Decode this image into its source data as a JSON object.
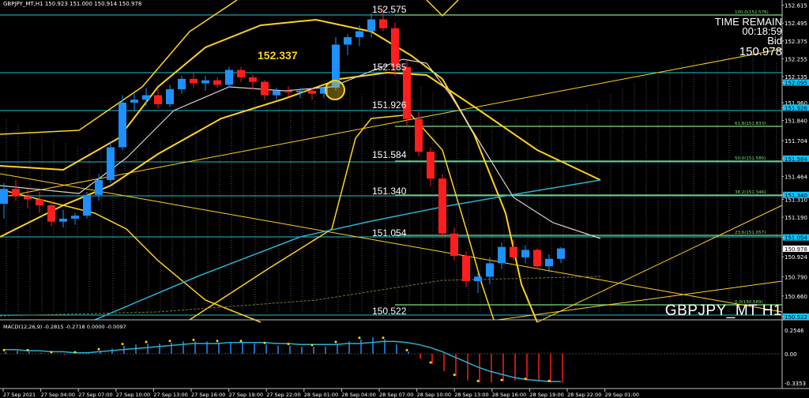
{
  "window": {
    "symbol_header": "GBPJPY_MT,H1  150.923 151.000 150.914 150.978",
    "time_remain_label": "TIME REMAIN",
    "time_remain_value": "00:18:59",
    "bid_label": "Bid",
    "bid_value": "150.978",
    "symbol_label": "GBPJPY_MT H1"
  },
  "levels": {
    "l1": "152.575",
    "l2": "152.337",
    "l3": "152.185",
    "l4": "151.926",
    "l5": "151.584",
    "l6": "151.340",
    "l7": "151.054",
    "l8": "150.522"
  },
  "fib_labels": [
    "100.0(152.576)",
    "61.8(151.833)",
    "50.0(151.580)",
    "38.2(151.346)",
    "23.6(151.057)",
    "0.0(150.589)"
  ],
  "price_axis": {
    "ticks": [
      "152.615",
      "152.495",
      "152.375",
      "152.255",
      "152.135",
      "152.095",
      "151.960",
      "151.926",
      "151.840",
      "151.704",
      "151.584",
      "151.464",
      "151.340",
      "151.310",
      "151.190",
      "151.054",
      "150.978",
      "150.924",
      "150.790",
      "150.660",
      "150.522"
    ],
    "highlight": {
      "152.575": "#00c8ff",
      "152.095": "#00c8ff",
      "151.926": "#00c8ff",
      "151.584": "#00c8ff",
      "151.340": "#00c8ff",
      "151.054": "#00c8ff",
      "150.978": "#ffffff",
      "150.522": "#00c8ff"
    }
  },
  "time_axis": {
    "ticks": [
      "27 Sep 2021",
      "27 Sep 04:00",
      "27 Sep 07:00",
      "27 Sep 10:00",
      "27 Sep 13:00",
      "27 Sep 16:00",
      "27 Sep 19:00",
      "27 Sep 22:00",
      "28 Sep 01:00",
      "28 Sep 04:00",
      "28 Sep 07:00",
      "28 Sep 10:00",
      "28 Sep 13:00",
      "28 Sep 16:00",
      "28 Sep 19:00",
      "28 Sep 22:00",
      "29 Sep 01:00"
    ]
  },
  "macd": {
    "header": "MACD(12,26,9) -0.2815 -0.2718 0.0000 -0.0097",
    "ticks": [
      "0.2546",
      "0.00",
      "-0.3353"
    ]
  },
  "colors": {
    "bull": "#1e90ff",
    "bear": "#ff1e1e",
    "ma_yellow": "#ffd21e",
    "ma_cyan": "#2ab0d0",
    "level": "#7fdc7f"
  },
  "chart_data": {
    "type": "candlestick",
    "symbol": "GBPJPY_MT",
    "timeframe": "H1",
    "ylim": [
      150.5,
      152.65
    ],
    "x": [
      "27 Sep 00:00",
      "01:00",
      "02:00",
      "03:00",
      "04:00",
      "05:00",
      "06:00",
      "07:00",
      "08:00",
      "09:00",
      "10:00",
      "11:00",
      "12:00",
      "13:00",
      "14:00",
      "15:00",
      "16:00",
      "17:00",
      "18:00",
      "19:00",
      "20:00",
      "21:00",
      "22:00",
      "23:00",
      "28 Sep 00:00",
      "01:00",
      "02:00",
      "03:00",
      "04:00",
      "05:00",
      "06:00",
      "07:00",
      "08:00",
      "09:00",
      "10:00",
      "11:00",
      "12:00",
      "13:00",
      "14:00",
      "15:00",
      "16:00",
      "17:00",
      "18:00",
      "19:00",
      "20:00",
      "21:00",
      "22:00",
      "23:00",
      "29 Sep 00:00",
      "01:00"
    ],
    "ohlc": [
      [
        151.28,
        151.42,
        151.18,
        151.38
      ],
      [
        151.38,
        151.44,
        151.3,
        151.33
      ],
      [
        151.33,
        151.38,
        151.25,
        151.31
      ],
      [
        151.31,
        151.36,
        151.22,
        151.27
      ],
      [
        151.27,
        151.3,
        151.13,
        151.16
      ],
      [
        151.16,
        151.24,
        151.12,
        151.18
      ],
      [
        151.18,
        151.22,
        151.14,
        151.2
      ],
      [
        151.2,
        151.36,
        151.18,
        151.34
      ],
      [
        151.34,
        151.48,
        151.3,
        151.44
      ],
      [
        151.44,
        151.7,
        151.42,
        151.66
      ],
      [
        151.66,
        152.01,
        151.64,
        151.96
      ],
      [
        151.96,
        152.02,
        151.9,
        151.98
      ],
      [
        151.98,
        152.06,
        151.94,
        152.01
      ],
      [
        152.01,
        152.05,
        151.92,
        151.95
      ],
      [
        151.95,
        152.08,
        151.93,
        152.05
      ],
      [
        152.05,
        152.14,
        152.02,
        152.12
      ],
      [
        152.12,
        152.16,
        152.06,
        152.09
      ],
      [
        152.09,
        152.14,
        152.04,
        152.11
      ],
      [
        152.11,
        152.13,
        152.06,
        152.08
      ],
      [
        152.08,
        152.2,
        152.06,
        152.18
      ],
      [
        152.18,
        152.2,
        152.1,
        152.13
      ],
      [
        152.13,
        152.15,
        152.05,
        152.1
      ],
      [
        152.1,
        152.11,
        151.98,
        152.01
      ],
      [
        152.01,
        152.06,
        151.98,
        152.04
      ],
      [
        152.04,
        152.07,
        152.0,
        152.03
      ],
      [
        152.03,
        152.06,
        151.99,
        152.04
      ],
      [
        152.04,
        152.06,
        151.98,
        152.02
      ],
      [
        152.02,
        152.08,
        151.99,
        152.06
      ],
      [
        152.06,
        152.4,
        152.04,
        152.35
      ],
      [
        152.35,
        152.42,
        152.28,
        152.4
      ],
      [
        152.4,
        152.48,
        152.34,
        152.44
      ],
      [
        152.44,
        152.56,
        152.4,
        152.52
      ],
      [
        152.52,
        152.6,
        152.44,
        152.46
      ],
      [
        152.46,
        152.5,
        152.14,
        152.2
      ],
      [
        152.2,
        152.24,
        151.8,
        151.85
      ],
      [
        151.85,
        151.9,
        151.6,
        151.63
      ],
      [
        151.63,
        151.66,
        151.4,
        151.45
      ],
      [
        151.45,
        151.48,
        151.05,
        151.08
      ],
      [
        151.08,
        151.12,
        150.9,
        150.93
      ],
      [
        150.93,
        150.96,
        150.72,
        150.76
      ],
      [
        150.76,
        150.82,
        150.68,
        150.79
      ],
      [
        150.79,
        150.92,
        150.74,
        150.88
      ],
      [
        150.88,
        151.02,
        150.84,
        150.99
      ],
      [
        150.99,
        151.04,
        150.9,
        150.92
      ],
      [
        150.92,
        151.0,
        150.88,
        150.97
      ],
      [
        150.97,
        150.98,
        150.84,
        150.86
      ],
      [
        150.86,
        150.94,
        150.82,
        150.91
      ],
      [
        150.91,
        150.99,
        150.88,
        150.98
      ]
    ],
    "macd_histogram": [
      0.02,
      0.03,
      0.02,
      0.01,
      0.0,
      -0.01,
      0.0,
      0.01,
      0.03,
      0.05,
      0.08,
      0.09,
      0.1,
      0.1,
      0.11,
      0.12,
      0.12,
      0.12,
      0.11,
      0.11,
      0.11,
      0.1,
      0.09,
      0.08,
      0.08,
      0.07,
      0.07,
      0.07,
      0.1,
      0.12,
      0.14,
      0.16,
      0.14,
      0.09,
      0.02,
      -0.05,
      -0.1,
      -0.17,
      -0.22,
      -0.26,
      -0.28,
      -0.28,
      -0.27,
      -0.26,
      -0.26,
      -0.27,
      -0.28,
      -0.28
    ],
    "macd_signal": [
      0.04,
      0.04,
      0.03,
      0.03,
      0.02,
      0.02,
      0.01,
      0.01,
      0.02,
      0.03,
      0.04,
      0.05,
      0.06,
      0.07,
      0.08,
      0.09,
      0.1,
      0.1,
      0.1,
      0.11,
      0.11,
      0.11,
      0.11,
      0.1,
      0.1,
      0.09,
      0.09,
      0.09,
      0.09,
      0.1,
      0.1,
      0.11,
      0.12,
      0.12,
      0.11,
      0.09,
      0.06,
      0.02,
      -0.03,
      -0.08,
      -0.13,
      -0.17,
      -0.2,
      -0.23,
      -0.25,
      -0.26,
      -0.27,
      -0.27
    ]
  }
}
